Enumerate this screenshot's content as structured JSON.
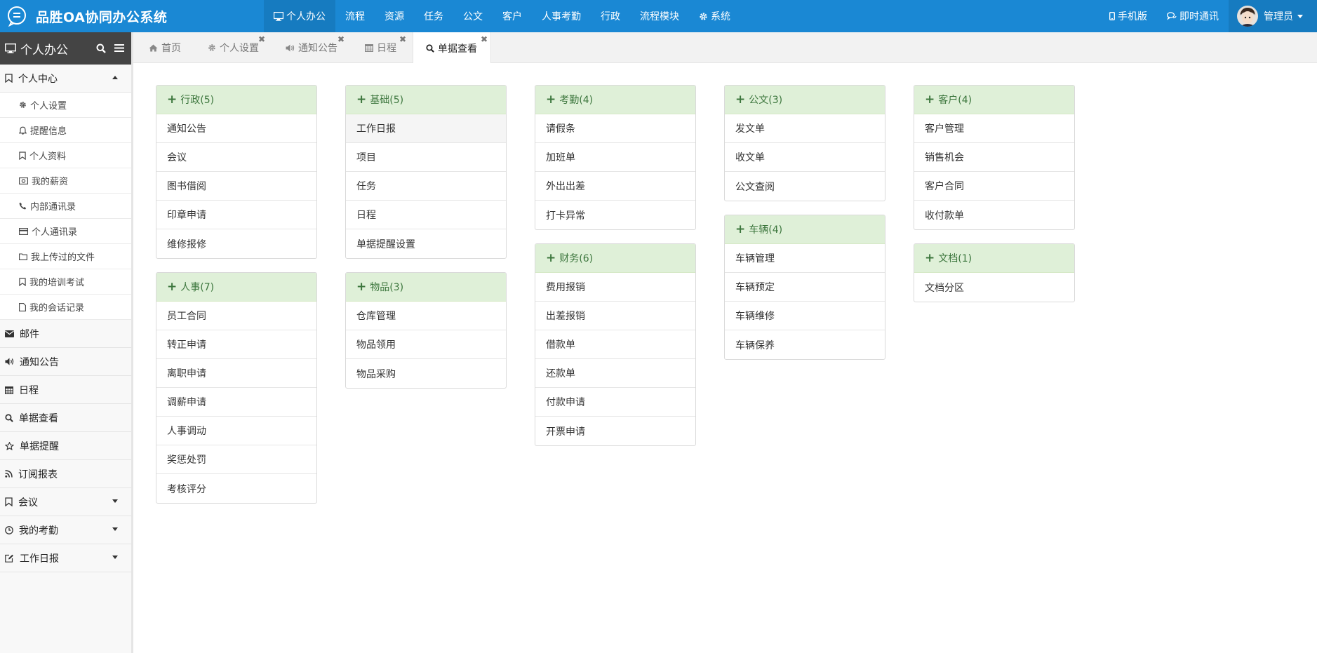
{
  "app": {
    "title": "品胜OA协同办公系统"
  },
  "topnav": [
    {
      "label": "个人办公",
      "icon": "monitor-icon",
      "active": true
    },
    {
      "label": "流程"
    },
    {
      "label": "资源"
    },
    {
      "label": "任务"
    },
    {
      "label": "公文"
    },
    {
      "label": "客户"
    },
    {
      "label": "人事考勤"
    },
    {
      "label": "行政"
    },
    {
      "label": "流程模块"
    },
    {
      "label": "系统",
      "icon": "gear-icon"
    }
  ],
  "topright": {
    "mobile": "手机版",
    "im": "即时通讯",
    "user": "管理员"
  },
  "sidebar": {
    "title": "个人办公",
    "personal_center": "个人中心",
    "subitems": [
      "个人设置",
      "提醒信息",
      "个人资料",
      "我的薪资",
      "内部通讯录",
      "个人通讯录",
      "我上传过的文件",
      "我的培训考试",
      "我的会话记录"
    ],
    "groups": [
      "邮件",
      "通知公告",
      "日程",
      "单据查看",
      "单据提醒",
      "订阅报表",
      "会议",
      "我的考勤",
      "工作日报"
    ]
  },
  "tabs": [
    "首页",
    "个人设置",
    "通知公告",
    "日程",
    "单据查看"
  ],
  "panels": {
    "xingzheng": {
      "title": "行政(5)",
      "items": [
        "通知公告",
        "会议",
        "图书借阅",
        "印章申请",
        "维修报修"
      ]
    },
    "renshi": {
      "title": "人事(7)",
      "items": [
        "员工合同",
        "转正申请",
        "离职申请",
        "调薪申请",
        "人事调动",
        "奖惩处罚",
        "考核评分"
      ]
    },
    "jichu": {
      "title": "基础(5)",
      "items": [
        "工作日报",
        "项目",
        "任务",
        "日程",
        "单据提醒设置"
      ]
    },
    "wupin": {
      "title": "物品(3)",
      "items": [
        "仓库管理",
        "物品领用",
        "物品采购"
      ]
    },
    "kaoqin": {
      "title": "考勤(4)",
      "items": [
        "请假条",
        "加班单",
        "外出出差",
        "打卡异常"
      ]
    },
    "caiwu": {
      "title": "财务(6)",
      "items": [
        "费用报销",
        "出差报销",
        "借款单",
        "还款单",
        "付款申请",
        "开票申请"
      ]
    },
    "gongwen": {
      "title": "公文(3)",
      "items": [
        "发文单",
        "收文单",
        "公文查阅"
      ]
    },
    "cheliang": {
      "title": "车辆(4)",
      "items": [
        "车辆管理",
        "车辆预定",
        "车辆维修",
        "车辆保养"
      ]
    },
    "kehu": {
      "title": "客户(4)",
      "items": [
        "客户管理",
        "销售机会",
        "客户合同",
        "收付款单"
      ]
    },
    "wendang": {
      "title": "文档(1)",
      "items": [
        "文档分区"
      ]
    }
  }
}
